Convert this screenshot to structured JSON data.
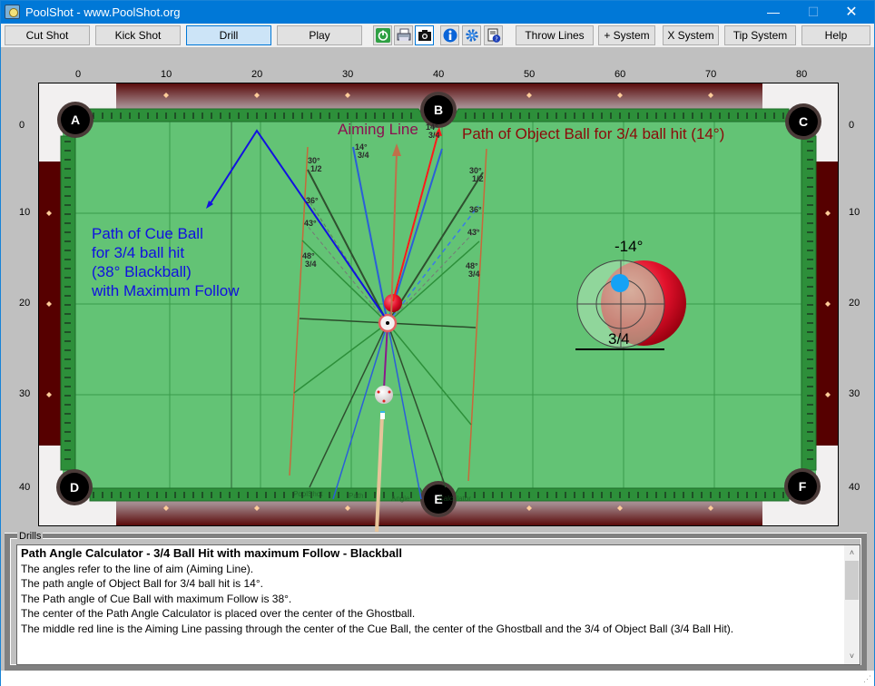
{
  "window": {
    "title": "PoolShot - www.PoolShot.org",
    "controls": {
      "minimize": "—",
      "maximize": "☐",
      "close": "✕"
    }
  },
  "toolbar": {
    "buttons": [
      {
        "label": "Cut Shot",
        "active": false
      },
      {
        "label": "Kick Shot",
        "active": false
      },
      {
        "label": "Drill",
        "active": true
      },
      {
        "label": "Play",
        "active": false
      }
    ],
    "icons": [
      "power-icon",
      "printer-icon",
      "camera-icon",
      "info-icon",
      "gear-icon",
      "help-document-icon"
    ],
    "right_buttons": [
      {
        "label": "Throw Lines"
      },
      {
        "label": "+ System"
      },
      {
        "label": "X System"
      },
      {
        "label": "Tip System"
      },
      {
        "label": "Help"
      }
    ]
  },
  "table": {
    "x_ruler": [
      "0",
      "10",
      "20",
      "30",
      "40",
      "50",
      "60",
      "70",
      "80"
    ],
    "y_ruler": [
      "0",
      "10",
      "20",
      "30",
      "40"
    ],
    "pockets": [
      "A",
      "B",
      "C",
      "D",
      "E",
      "F"
    ],
    "colors": {
      "felt": "#63c375",
      "cushion": "#2d8f3a",
      "rail": "#5a0000",
      "pocket": "#000000"
    },
    "annotations": {
      "aiming_line": "Aiming Line",
      "object_path": "Path of Object Ball for 3/4 ball hit (14°)",
      "cue_path": [
        "Path of Cue Ball",
        "for 3/4 ball hit",
        "(38° Blackball)",
        "with Maximum Follow"
      ],
      "calc_angle": "-14°",
      "calc_fraction": "3/4",
      "angle_labels": [
        {
          "deg": "14°",
          "frac": "3/4"
        },
        {
          "deg": "30°",
          "frac": "1/2"
        },
        {
          "deg": "36°",
          "frac": ""
        },
        {
          "deg": "43°",
          "frac": ""
        },
        {
          "deg": "48°",
          "frac": "3/4"
        }
      ],
      "rail_watermark": [
        "PoolShot",
        "Path",
        "Angle",
        "Calculator"
      ]
    }
  },
  "drills": {
    "legend": "Drills",
    "heading": "Path Angle Calculator - 3/4 Ball Hit with maximum Follow - Blackball",
    "lines": [
      "The angles refer to the line of aim (Aiming Line).",
      "The path angle of Object Ball for 3/4 ball hit is 14°.",
      "The Path angle of Cue Ball with maximum Follow is 38°.",
      "The center of the Path Angle Calculator is placed over the center of the Ghostball.",
      "The middle red line is the Aiming Line passing through the center of the Cue Ball, the center of the Ghostball and the 3/4 of Object Ball (3/4 Ball Hit)."
    ]
  }
}
